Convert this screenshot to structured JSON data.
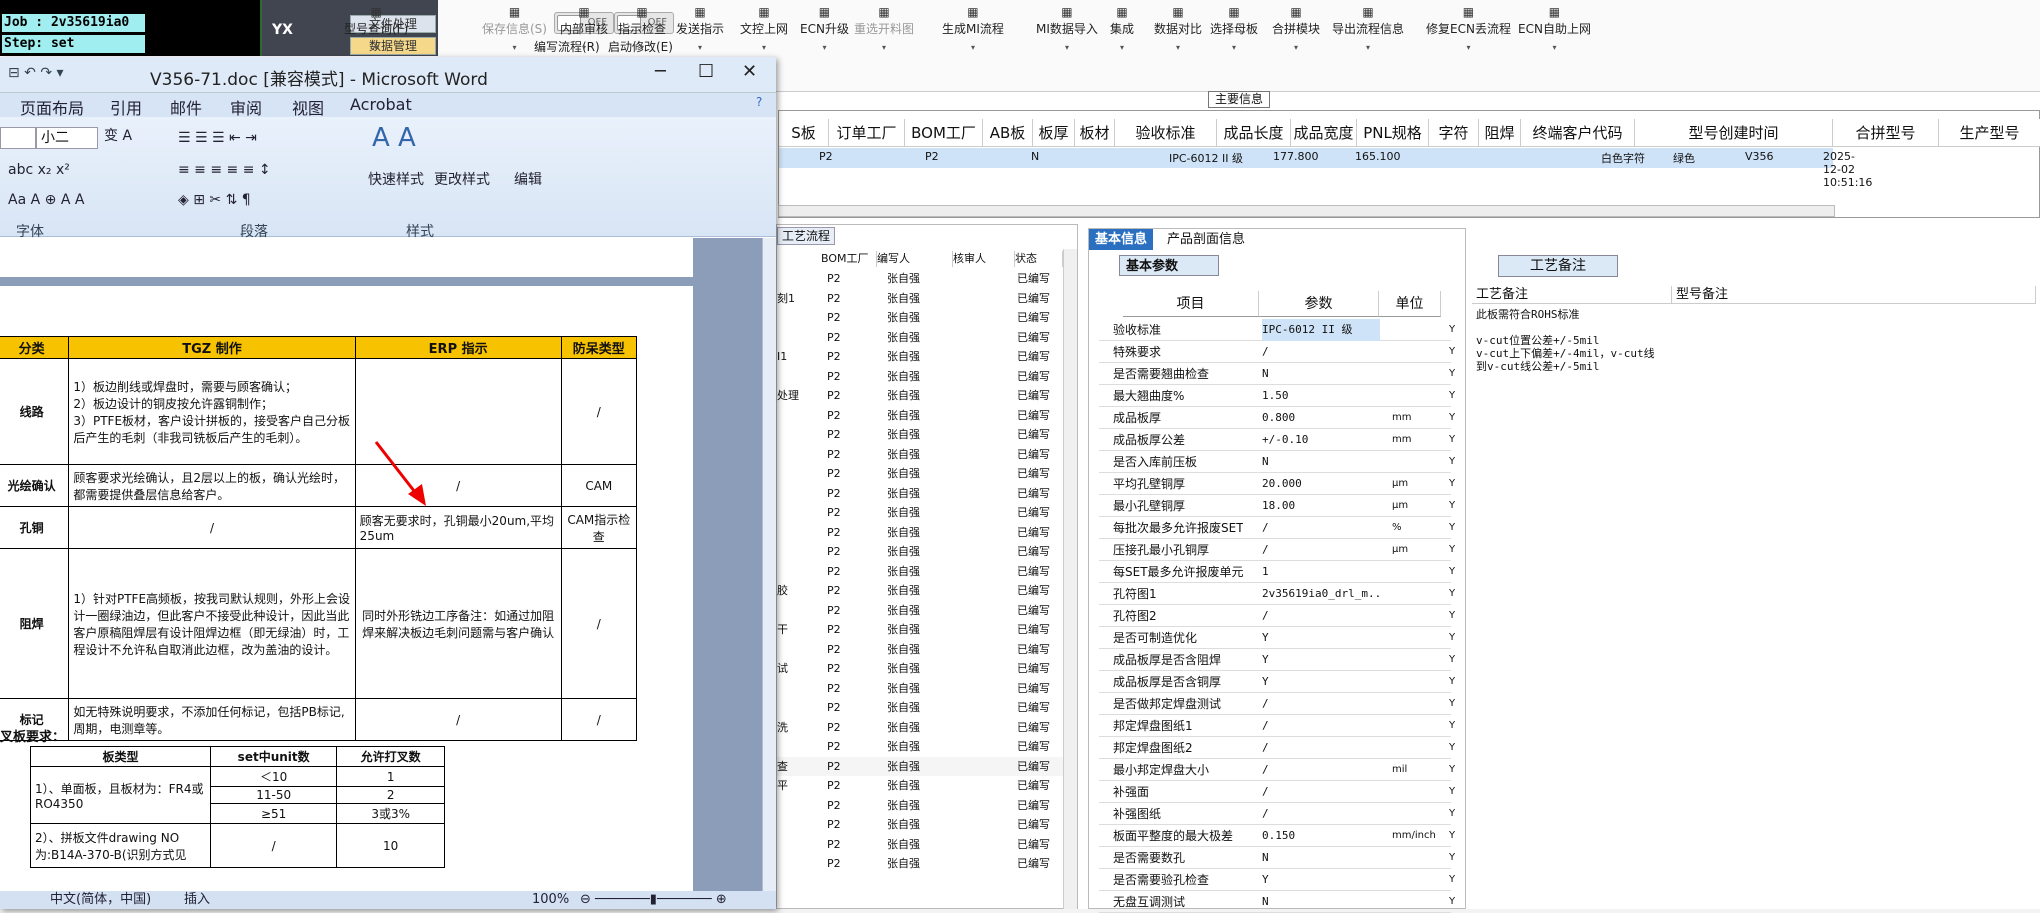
{
  "terminal": {
    "job": "Job : 2v35619ia0",
    "step": "Step: set"
  },
  "vmenu": {
    "logo": "YX",
    "items": [
      "文件处理",
      "数据管理"
    ]
  },
  "toggles": [
    {
      "label": "编写流程(R)",
      "state": "OFF"
    },
    {
      "label": "启动修改(E)",
      "state": "OFF"
    }
  ],
  "ribbon": [
    "型号查询(F)",
    "保存信息(S)",
    "内部审核",
    "指示检查",
    "发送指示",
    "文控上网",
    "ECN升级",
    "重选开料图",
    "生成MI流程",
    "MI数据导入",
    "集成",
    "数据对比",
    "选择母板",
    "合拼模块",
    "导出流程信息",
    "修复ECN丢流程",
    "ECN自助上网"
  ],
  "main_info_label": "主要信息",
  "grid": {
    "headers": [
      "S板",
      "订单工厂",
      "BOM工厂",
      "AB板",
      "板厚",
      "板材",
      "验收标准",
      "成品长度",
      "成品宽度",
      "PNL规格",
      "字符",
      "阻焊",
      "终端客户代码",
      "型号创建时间",
      "合拼型号",
      "生产型号"
    ],
    "row": [
      "P2",
      "P2",
      "N",
      "IPC-6012 II 级",
      "177.800",
      "165.100",
      "白色字符",
      "绿色",
      "V356",
      "2025-12-02 10:51:16"
    ]
  },
  "process": {
    "tab": "工艺流程",
    "headers": [
      "BOM工厂",
      "编写人",
      "核审人",
      "状态"
    ],
    "rows": [
      [
        "",
        "P2",
        "张自强",
        "已编写"
      ],
      [
        "刻1",
        "P2",
        "张自强",
        "已编写"
      ],
      [
        "",
        "P2",
        "张自强",
        "已编写"
      ],
      [
        "",
        "P2",
        "张自强",
        "已编写"
      ],
      [
        "I1",
        "P2",
        "张自强",
        "已编写"
      ],
      [
        "",
        "P2",
        "张自强",
        "已编写"
      ],
      [
        "处理",
        "P2",
        "张自强",
        "已编写"
      ],
      [
        "",
        "P2",
        "张自强",
        "已编写"
      ],
      [
        "",
        "P2",
        "张自强",
        "已编写"
      ],
      [
        "",
        "P2",
        "张自强",
        "已编写"
      ],
      [
        "",
        "P2",
        "张自强",
        "已编写"
      ],
      [
        "",
        "P2",
        "张自强",
        "已编写"
      ],
      [
        "",
        "P2",
        "张自强",
        "已编写"
      ],
      [
        "",
        "P2",
        "张自强",
        "已编写"
      ],
      [
        "",
        "P2",
        "张自强",
        "已编写"
      ],
      [
        "",
        "P2",
        "张自强",
        "已编写"
      ],
      [
        "胶",
        "P2",
        "张自强",
        "已编写"
      ],
      [
        "",
        "P2",
        "张自强",
        "已编写"
      ],
      [
        "干",
        "P2",
        "张自强",
        "已编写"
      ],
      [
        "",
        "P2",
        "张自强",
        "已编写"
      ],
      [
        "试",
        "P2",
        "张自强",
        "已编写"
      ],
      [
        "",
        "P2",
        "张自强",
        "已编写"
      ],
      [
        "",
        "P2",
        "张自强",
        "已编写"
      ],
      [
        "洗",
        "P2",
        "张自强",
        "已编写"
      ],
      [
        "",
        "P2",
        "张自强",
        "已编写"
      ],
      [
        "查",
        "P2",
        "张自强",
        "已编写"
      ],
      [
        "平",
        "P2",
        "张自强",
        "已编写"
      ],
      [
        "",
        "P2",
        "张自强",
        "已编写"
      ],
      [
        "",
        "P2",
        "张自强",
        "已编写"
      ],
      [
        "",
        "P2",
        "张自强",
        "已编写"
      ],
      [
        "",
        "P2",
        "张自强",
        "已编写"
      ]
    ]
  },
  "basic": {
    "tabs": [
      "基本信息",
      "产品剖面信息"
    ],
    "subtab": "基本参数",
    "headers": [
      "项目",
      "参数",
      "单位"
    ],
    "rows": [
      [
        "验收标准",
        "IPC-6012 II 级",
        "",
        "Y"
      ],
      [
        "特殊要求",
        "/",
        "",
        "Y"
      ],
      [
        "是否需要翘曲检查",
        "N",
        "",
        "Y"
      ],
      [
        "最大翘曲度%",
        "1.50",
        "",
        "Y"
      ],
      [
        "成品板厚",
        "0.800",
        "mm",
        "Y"
      ],
      [
        "成品板厚公差",
        "+/-0.10",
        "mm",
        "Y"
      ],
      [
        "是否入库前压板",
        "N",
        "",
        "Y"
      ],
      [
        "平均孔壁铜厚",
        "20.000",
        "μm",
        "Y"
      ],
      [
        "最小孔壁铜厚",
        "18.00",
        "μm",
        "Y"
      ],
      [
        "每批次最多允许报废SET",
        "/",
        "%",
        "Y"
      ],
      [
        "压接孔最小孔铜厚",
        "/",
        "μm",
        "Y"
      ],
      [
        "每SET最多允许报废单元",
        "1",
        "",
        "Y"
      ],
      [
        "孔符图1",
        "2v35619ia0_drl_m...",
        "",
        "Y"
      ],
      [
        "孔符图2",
        "/",
        "",
        "Y"
      ],
      [
        "是否可制造优化",
        "Y",
        "",
        "Y"
      ],
      [
        "成品板厚是否含阻焊",
        "Y",
        "",
        "Y"
      ],
      [
        "成品板厚是否含铜厚",
        "Y",
        "",
        "Y"
      ],
      [
        "是否做邦定焊盘测试",
        "/",
        "",
        "Y"
      ],
      [
        "邦定焊盘图纸1",
        "/",
        "",
        "Y"
      ],
      [
        "邦定焊盘图纸2",
        "/",
        "",
        "Y"
      ],
      [
        "最小邦定焊盘大小",
        "/",
        "mil",
        "Y"
      ],
      [
        "补强面",
        "/",
        "",
        "Y"
      ],
      [
        "补强图纸",
        "/",
        "",
        "Y"
      ],
      [
        "板面平整度的最大极差",
        "0.150",
        "mm/inch",
        "Y"
      ],
      [
        "是否需要数孔",
        "N",
        "",
        "Y"
      ],
      [
        "是否需要验孔检查",
        "Y",
        "",
        "Y"
      ],
      [
        "无盘互调测试",
        "N",
        "",
        "Y"
      ]
    ]
  },
  "notes": {
    "tab": "工艺备注",
    "cols": [
      "工艺备注",
      "型号备注"
    ],
    "text": "此板需符合ROHS标准\n\nv-cut位置公差+/-5mil\nv-cut上下偏差+/-4mil，v-cut线\n到v-cut线公差+/-5mil"
  },
  "word": {
    "title": "V356-71.doc [兼容模式] - Microsoft Word",
    "menu": [
      "页面布局",
      "引用",
      "邮件",
      "审阅",
      "视图",
      "Acrobat"
    ],
    "font_size": "小二",
    "groups": [
      "字体",
      "段落",
      "样式",
      "编辑"
    ],
    "style_btns": [
      "快速样式",
      "更改样式",
      "编辑"
    ],
    "table_headers": [
      "分类",
      "TGZ 制作",
      "ERP 指示",
      "防呆类型"
    ],
    "rows": [
      {
        "cat": "线路",
        "items": [
          "1）板边削线或焊盘时，需要与顾客确认；",
          "2）板边设计的铜皮按允许露铜制作；",
          "3）PTFE板材，客户设计拼板的，接受客户自己分板后产生的毛刺（非我司铣板后产生的毛刺）。"
        ],
        "erp": "",
        "type": "/"
      },
      {
        "cat": "光绘确认",
        "items": [
          "顾客要求光绘确认，且2层以上的板，确认光绘时，都需要提供叠层信息给客户。"
        ],
        "erp": "/",
        "type": "CAM"
      },
      {
        "cat": "孔铜",
        "items": [
          "/"
        ],
        "erp": "顾客无要求时，孔铜最小20um,平均25um",
        "type": "CAM指示检查"
      },
      {
        "cat": "阻焊",
        "items": [
          "1）针对PTFE高频板，按我司默认规则，外形上会设计一圈绿油边，但此客户不接受此种设计，因此当此客户原稿阻焊层有设计阻焊边框（即无绿油）时，工程设计不允许私自取消此边框，改为盖油的设计。"
        ],
        "erp": "同时外形铣边工序备注：如通过加阻焊来解决板边毛刺问题需与客户确认",
        "type": "/"
      },
      {
        "cat": "标记",
        "items": [
          "如无特殊说明要求，不添加任何标记，包括PB标记,周期，电测章等。"
        ],
        "erp": "/",
        "type": "/"
      }
    ],
    "req_title": "叉板要求：",
    "t2_headers": [
      "板类型",
      "set中unit数",
      "允许打叉数"
    ],
    "t2_rows": [
      [
        "1）、单面板，且板材为：FR4或RO4350",
        "＜10",
        "1"
      ],
      [
        "",
        "11-50",
        "2"
      ],
      [
        "",
        "≥51",
        "3或3%"
      ],
      [
        "2）、拼板文件drawing NO为:B14A-370-B(识别方式见",
        "/",
        "10"
      ]
    ],
    "status": {
      "lang": "中文(简体，中国)",
      "mode": "插入",
      "zoom": "100%"
    }
  }
}
